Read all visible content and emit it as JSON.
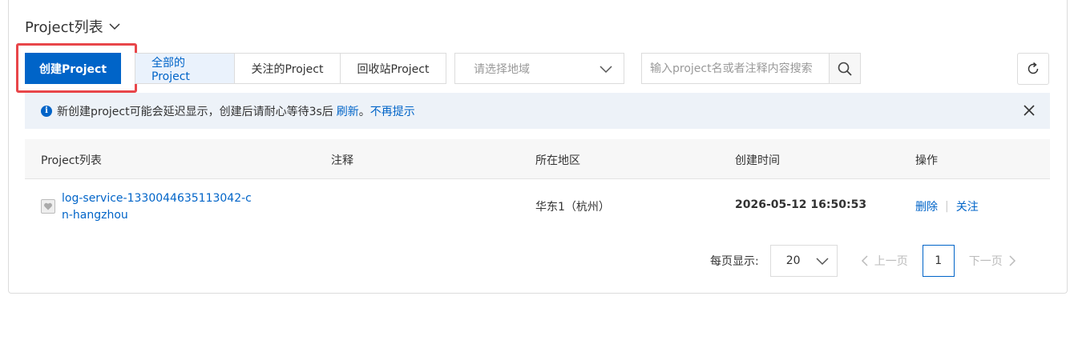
{
  "header": {
    "title": "Project列表"
  },
  "toolbar": {
    "create_label": "创建Project",
    "tabs": [
      {
        "label": "全部的Project",
        "active": true
      },
      {
        "label": "关注的Project",
        "active": false
      },
      {
        "label": "回收站Project",
        "active": false
      }
    ],
    "region_placeholder": "请选择地域",
    "search_placeholder": "输入project名或者注释内容搜索"
  },
  "notice": {
    "text": "新创建project可能会延迟显示，创建后请耐心等待3s后",
    "refresh_link": "刷新",
    "separator": "。",
    "dismiss_link": "不再提示"
  },
  "table": {
    "columns": [
      "Project列表",
      "注释",
      "所在地区",
      "创建时间",
      "操作"
    ],
    "rows": [
      {
        "name": "log-service-1330044635113042-cn-hangzhou",
        "comment": "",
        "region": "华东1（杭州）",
        "created": "2026-05-12 16:50:53",
        "actions": [
          "删除",
          "关注"
        ]
      }
    ]
  },
  "pagination": {
    "per_page_label": "每页显示:",
    "page_size": "20",
    "prev_label": "上一页",
    "current_page": "1",
    "next_label": "下一页"
  },
  "colors": {
    "primary": "#0064c8",
    "highlight": "#e8464a",
    "notice_bg": "#edf2f8"
  }
}
